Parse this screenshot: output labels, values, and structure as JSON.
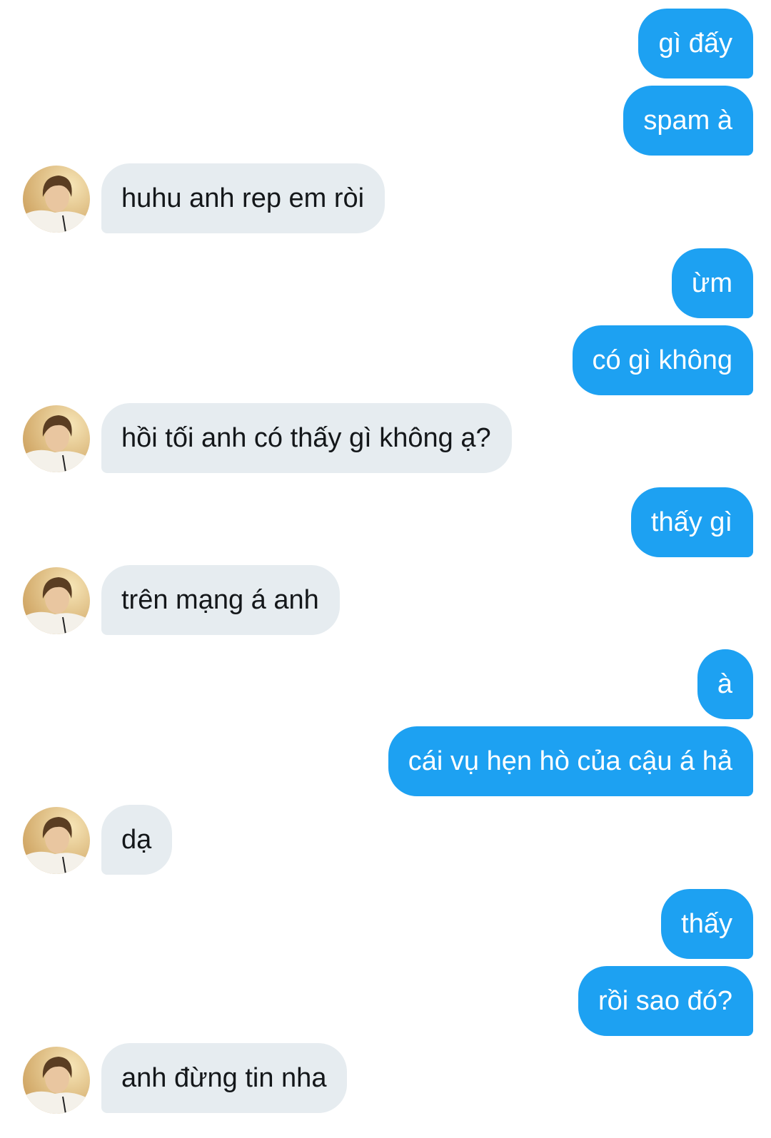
{
  "conversation": {
    "messages": [
      {
        "sender": "me",
        "text": "gì đấy"
      },
      {
        "sender": "me",
        "text": "spam à"
      },
      {
        "sender": "them",
        "text": "huhu anh rep em ròi"
      },
      {
        "sender": "me",
        "text": "ừm"
      },
      {
        "sender": "me",
        "text": "có gì không"
      },
      {
        "sender": "them",
        "text": "hồi tối anh có thấy gì không ạ?"
      },
      {
        "sender": "me",
        "text": "thấy gì"
      },
      {
        "sender": "them",
        "text": "trên mạng á anh"
      },
      {
        "sender": "me",
        "text": "à"
      },
      {
        "sender": "me",
        "text": "cái vụ hẹn hò của cậu á hả"
      },
      {
        "sender": "them",
        "text": "dạ"
      },
      {
        "sender": "me",
        "text": "thấy"
      },
      {
        "sender": "me",
        "text": "rồi sao đó?"
      },
      {
        "sender": "them",
        "text": "anh đừng tin nha"
      }
    ]
  },
  "avatar": {
    "icon": "contact-avatar"
  },
  "colors": {
    "sent_bubble": "#1da1f2",
    "sent_text": "#ffffff",
    "received_bubble": "#e6ecf0",
    "received_text": "#14171a",
    "background": "#ffffff"
  }
}
